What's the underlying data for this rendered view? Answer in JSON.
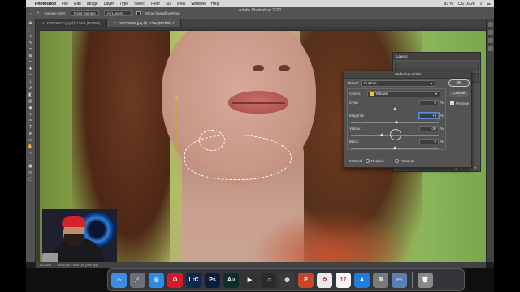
{
  "menubar": {
    "app": "Photoshop",
    "items": [
      "File",
      "Edit",
      "Image",
      "Layer",
      "Type",
      "Select",
      "Filter",
      "3D",
      "View",
      "Window",
      "Help"
    ],
    "status_right": [
      "93 %",
      "CS 16:26"
    ]
  },
  "window_title": "Adobe Photoshop 2020",
  "options_bar": {
    "sample_size_label": "Sample Size:",
    "sample_size_value": "Point Sample",
    "sample_label": "All Layers",
    "show_ring_label": "Show Sampling Ring"
  },
  "tabs": [
    {
      "label": "DSC08810.jpg @ 124% (RGB/8)",
      "active": false
    },
    {
      "label": "DSC00848.jpg @ 112% (RGB/8) *",
      "active": true
    }
  ],
  "status_bar": {
    "zoom": "111.83%",
    "doc_info": "6000 px x 4000 px (300 ppi)"
  },
  "layers_panel": {
    "title": "Layers"
  },
  "selective_color": {
    "title": "Selective Color",
    "preset_label": "Preset:",
    "preset_value": "Custom",
    "colors_label": "Colors:",
    "colors_value": "Yellows",
    "ok_label": "OK",
    "cancel_label": "Cancel",
    "preview_label": "Preview",
    "preview_checked": true,
    "sliders": [
      {
        "label": "Cyan:",
        "value": "0",
        "unit": "%",
        "fraction": 0.5
      },
      {
        "label": "Magenta:",
        "value": "+3",
        "unit": "%",
        "fraction": 0.515
      },
      {
        "label": "Yellow:",
        "value": "-30",
        "unit": "%",
        "fraction": 0.35
      },
      {
        "label": "Black:",
        "value": "0",
        "unit": "%",
        "fraction": 0.5
      }
    ],
    "method_label": "Method:",
    "method_relative": "Relative",
    "method_absolute": "Absolute",
    "method_selected": "Relative"
  },
  "dock": {
    "apps": [
      {
        "name": "Finder",
        "glyph": "☺",
        "color": "#3d8de0"
      },
      {
        "name": "Launchpad",
        "glyph": "🚀",
        "color": "#6a6f7a"
      },
      {
        "name": "Safari",
        "glyph": "◎",
        "color": "#2d8ae6"
      },
      {
        "name": "Opera",
        "glyph": "O",
        "color": "#d41a2a"
      },
      {
        "name": "Lightroom Classic",
        "glyph": "LrC",
        "color": "#0b2a4a"
      },
      {
        "name": "Photoshop",
        "glyph": "Ps",
        "color": "#0a1e3a"
      },
      {
        "name": "Audition",
        "glyph": "Au",
        "color": "#0b2e2a"
      },
      {
        "name": "Final Cut Pro",
        "glyph": "▶",
        "color": "#333"
      },
      {
        "name": "Logic Pro",
        "glyph": "♫",
        "color": "#2a2a2a"
      },
      {
        "name": "DaVinci Resolve",
        "glyph": "◍",
        "color": "#3a3a3a"
      },
      {
        "name": "Microsoft PowerPoint",
        "glyph": "P",
        "color": "#c8452a"
      },
      {
        "name": "Photos",
        "glyph": "✿",
        "color": "#eaeaea"
      },
      {
        "name": "Calendar",
        "glyph": "17",
        "color": "#f4f4f4"
      },
      {
        "name": "App Store",
        "glyph": "A",
        "color": "#1f7ce0"
      },
      {
        "name": "System Preferences",
        "glyph": "⚙",
        "color": "#7a7a7a"
      },
      {
        "name": "Preview",
        "glyph": "▭",
        "color": "#5a7fb0"
      },
      {
        "name": "Trash",
        "glyph": "🗑",
        "color": "#8a8a8a"
      }
    ]
  }
}
